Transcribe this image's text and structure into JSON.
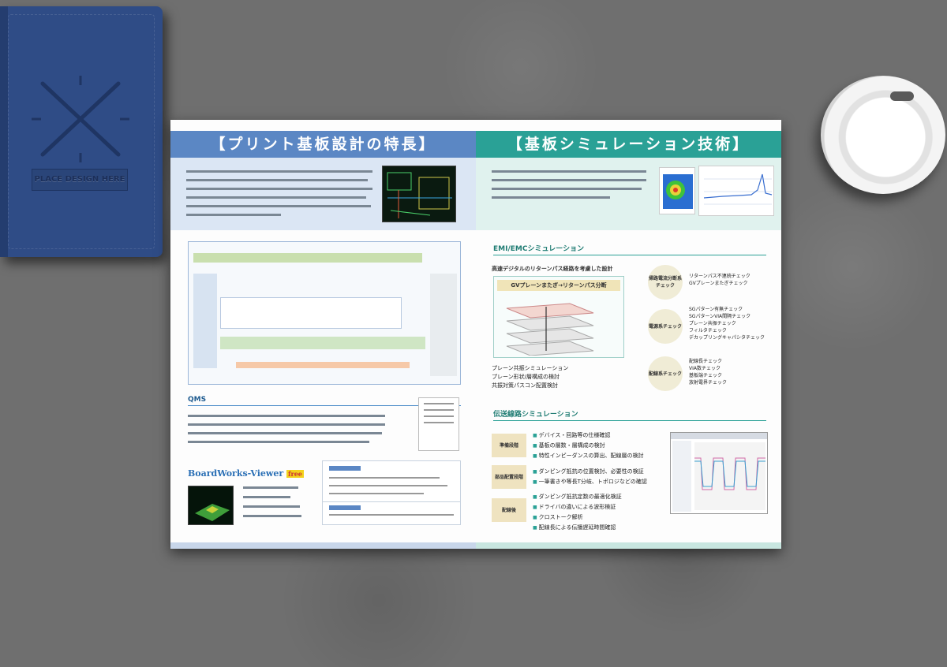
{
  "notebook": {
    "label": "PLACE DESIGN HERE"
  },
  "left": {
    "title": "【プリント基板設計の特長】",
    "qms_title": "QMS",
    "boardworks": {
      "title": "BoardWorks-Viewer",
      "badge": "free"
    }
  },
  "right": {
    "title": "【基板シミュレーション技術】",
    "emi_title": "EMI/EMCシミュレーション",
    "emi_subtitle": "高速デジタルのリターンパス経路を考慮した設計",
    "gv_title": "GVプレーンまたぎ→リターンパス分断",
    "emi_list": [
      "プレーン共振シミュレーション",
      "プレーン形状/層構成の検討",
      "共振対策パスコン配置検討"
    ],
    "emi_checks": [
      {
        "badge": "帰路電流分断系チェック",
        "items": [
          "リターンパス不連続チェック",
          "GVプレーンまたぎチェック"
        ]
      },
      {
        "badge": "電源系チェック",
        "items": [
          "SGパターン有無チェック",
          "SGパターンVIA間隔チェック",
          "プレーン共振チェック",
          "フィルタチェック",
          "デカップリングキャパシタチェック"
        ]
      },
      {
        "badge": "配線系チェック",
        "items": [
          "配線長チェック",
          "VIA数チェック",
          "基板端チェック",
          "放射電界チェック"
        ]
      }
    ],
    "trans_title": "伝送線路シミュレーション",
    "trans_stages": [
      {
        "label": "準備段階",
        "items": [
          "デバイス・回路等の仕様確認",
          "基板の層数・層構成の検討",
          "特性インピーダンスの算出、配線層の検討"
        ]
      },
      {
        "label": "部品配置段階",
        "items": [
          "ダンピング抵抗の位置検討、必要性の検証",
          "一筆書きや等長T分岐、トポロジなどの確認"
        ]
      },
      {
        "label": "配線後",
        "items": [
          "ダンピング抵抗定数の最適化検証",
          "ドライバの違いによる波形検証",
          "クロストーク解析",
          "配線長による伝播遅延時間確認"
        ]
      }
    ]
  }
}
